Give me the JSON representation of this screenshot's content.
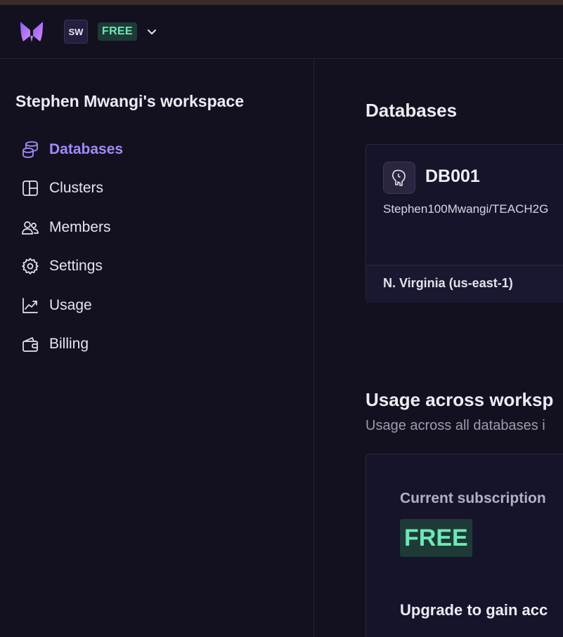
{
  "header": {
    "avatar_initials": "SW",
    "plan": "FREE",
    "plan_color": "#6ee7b7",
    "logo_colors": [
      "#c084fc",
      "#8b5cf6"
    ]
  },
  "sidebar": {
    "workspace_title": "Stephen Mwangi's workspace",
    "items": [
      {
        "label": "Databases",
        "icon": "database-icon",
        "active": true
      },
      {
        "label": "Clusters",
        "icon": "clusters-icon"
      },
      {
        "label": "Members",
        "icon": "members-icon"
      },
      {
        "label": "Settings",
        "icon": "gear-icon"
      },
      {
        "label": "Usage",
        "icon": "chart-icon"
      },
      {
        "label": "Billing",
        "icon": "wallet-icon"
      }
    ],
    "active_color": "#a48af8"
  },
  "main": {
    "databases_heading": "Databases",
    "database": {
      "name": "DB001",
      "path": "Stephen100Mwangi/TEACH2G",
      "region": "N. Virginia (us-east-1)",
      "icon": "postgres-elephant-icon"
    },
    "usage_heading": "Usage across worksp",
    "usage_subtitle": "Usage across all databases i",
    "subscription_label": "Current subscription",
    "subscription_plan": "FREE",
    "upgrade_text": "Upgrade to gain acc"
  }
}
